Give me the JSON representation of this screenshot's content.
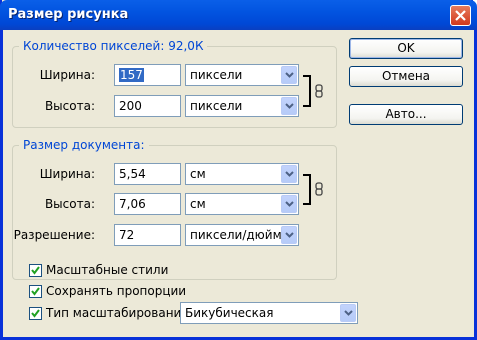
{
  "window": {
    "title": "Размер рисунка"
  },
  "pixel_dimensions": {
    "title": "Количество пикселей:",
    "size_value": "92,0К",
    "width_label": "Ширина:",
    "width_value": "157",
    "width_unit": "пиксели",
    "height_label": "Высота:",
    "height_value": "200",
    "height_unit": "пиксели"
  },
  "document_size": {
    "title": "Размер документа:",
    "width_label": "Ширина:",
    "width_value": "5,54",
    "width_unit": "см",
    "height_label": "Высота:",
    "height_value": "7,06",
    "height_unit": "см",
    "resolution_label": "Разрешение:",
    "resolution_value": "72",
    "resolution_unit": "пиксели/дюйм"
  },
  "options": {
    "scale_styles": {
      "label": "Масштабные стили",
      "checked": true
    },
    "constrain": {
      "label": "Сохранять пропорции",
      "checked": true
    },
    "resample": {
      "label": "Тип масштабирования:",
      "checked": true,
      "method": "Бикубическая"
    }
  },
  "buttons": {
    "ok": "OK",
    "cancel": "Отмена",
    "auto": "Авто..."
  }
}
